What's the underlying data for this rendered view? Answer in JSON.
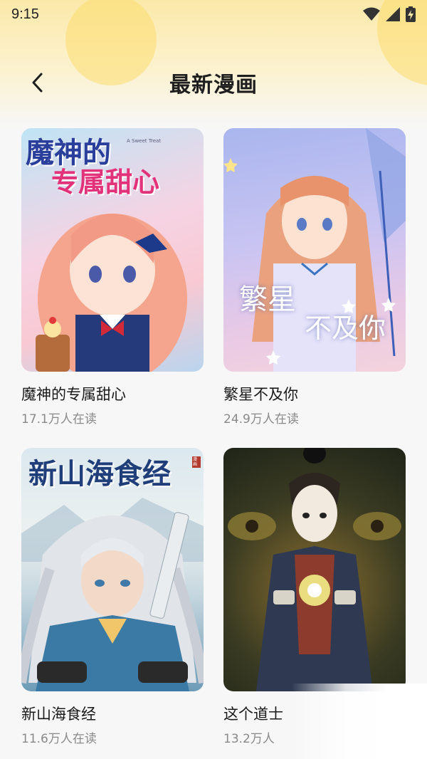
{
  "status_bar": {
    "time": "9:15",
    "icons": [
      "wifi-icon",
      "signal-icon",
      "battery-charging-icon"
    ]
  },
  "nav": {
    "back_icon": "chevron-left-icon",
    "title": "最新漫画"
  },
  "comics": [
    {
      "name": "魔神的专属甜心",
      "reads": "17.1万人在读",
      "cover_line1": "魔神的",
      "cover_line2": "专属甜心",
      "cover_tag": "A Sweet Treat"
    },
    {
      "name": "繁星不及你",
      "reads": "24.9万人在读",
      "cover_line1": "繁星",
      "cover_line2": "不及你"
    },
    {
      "name": "新山海食经",
      "reads": "11.6万人在读",
      "cover_line1": "新山海食经",
      "cover_seal": "漫画"
    },
    {
      "name": "这个道士",
      "reads": "13.2万人"
    }
  ],
  "colors": {
    "header_gradient_top": "#fbe9a9",
    "page_background": "#f7f7f7",
    "title_text": "#1e1e1e",
    "secondary_text": "#8a8a8a"
  }
}
